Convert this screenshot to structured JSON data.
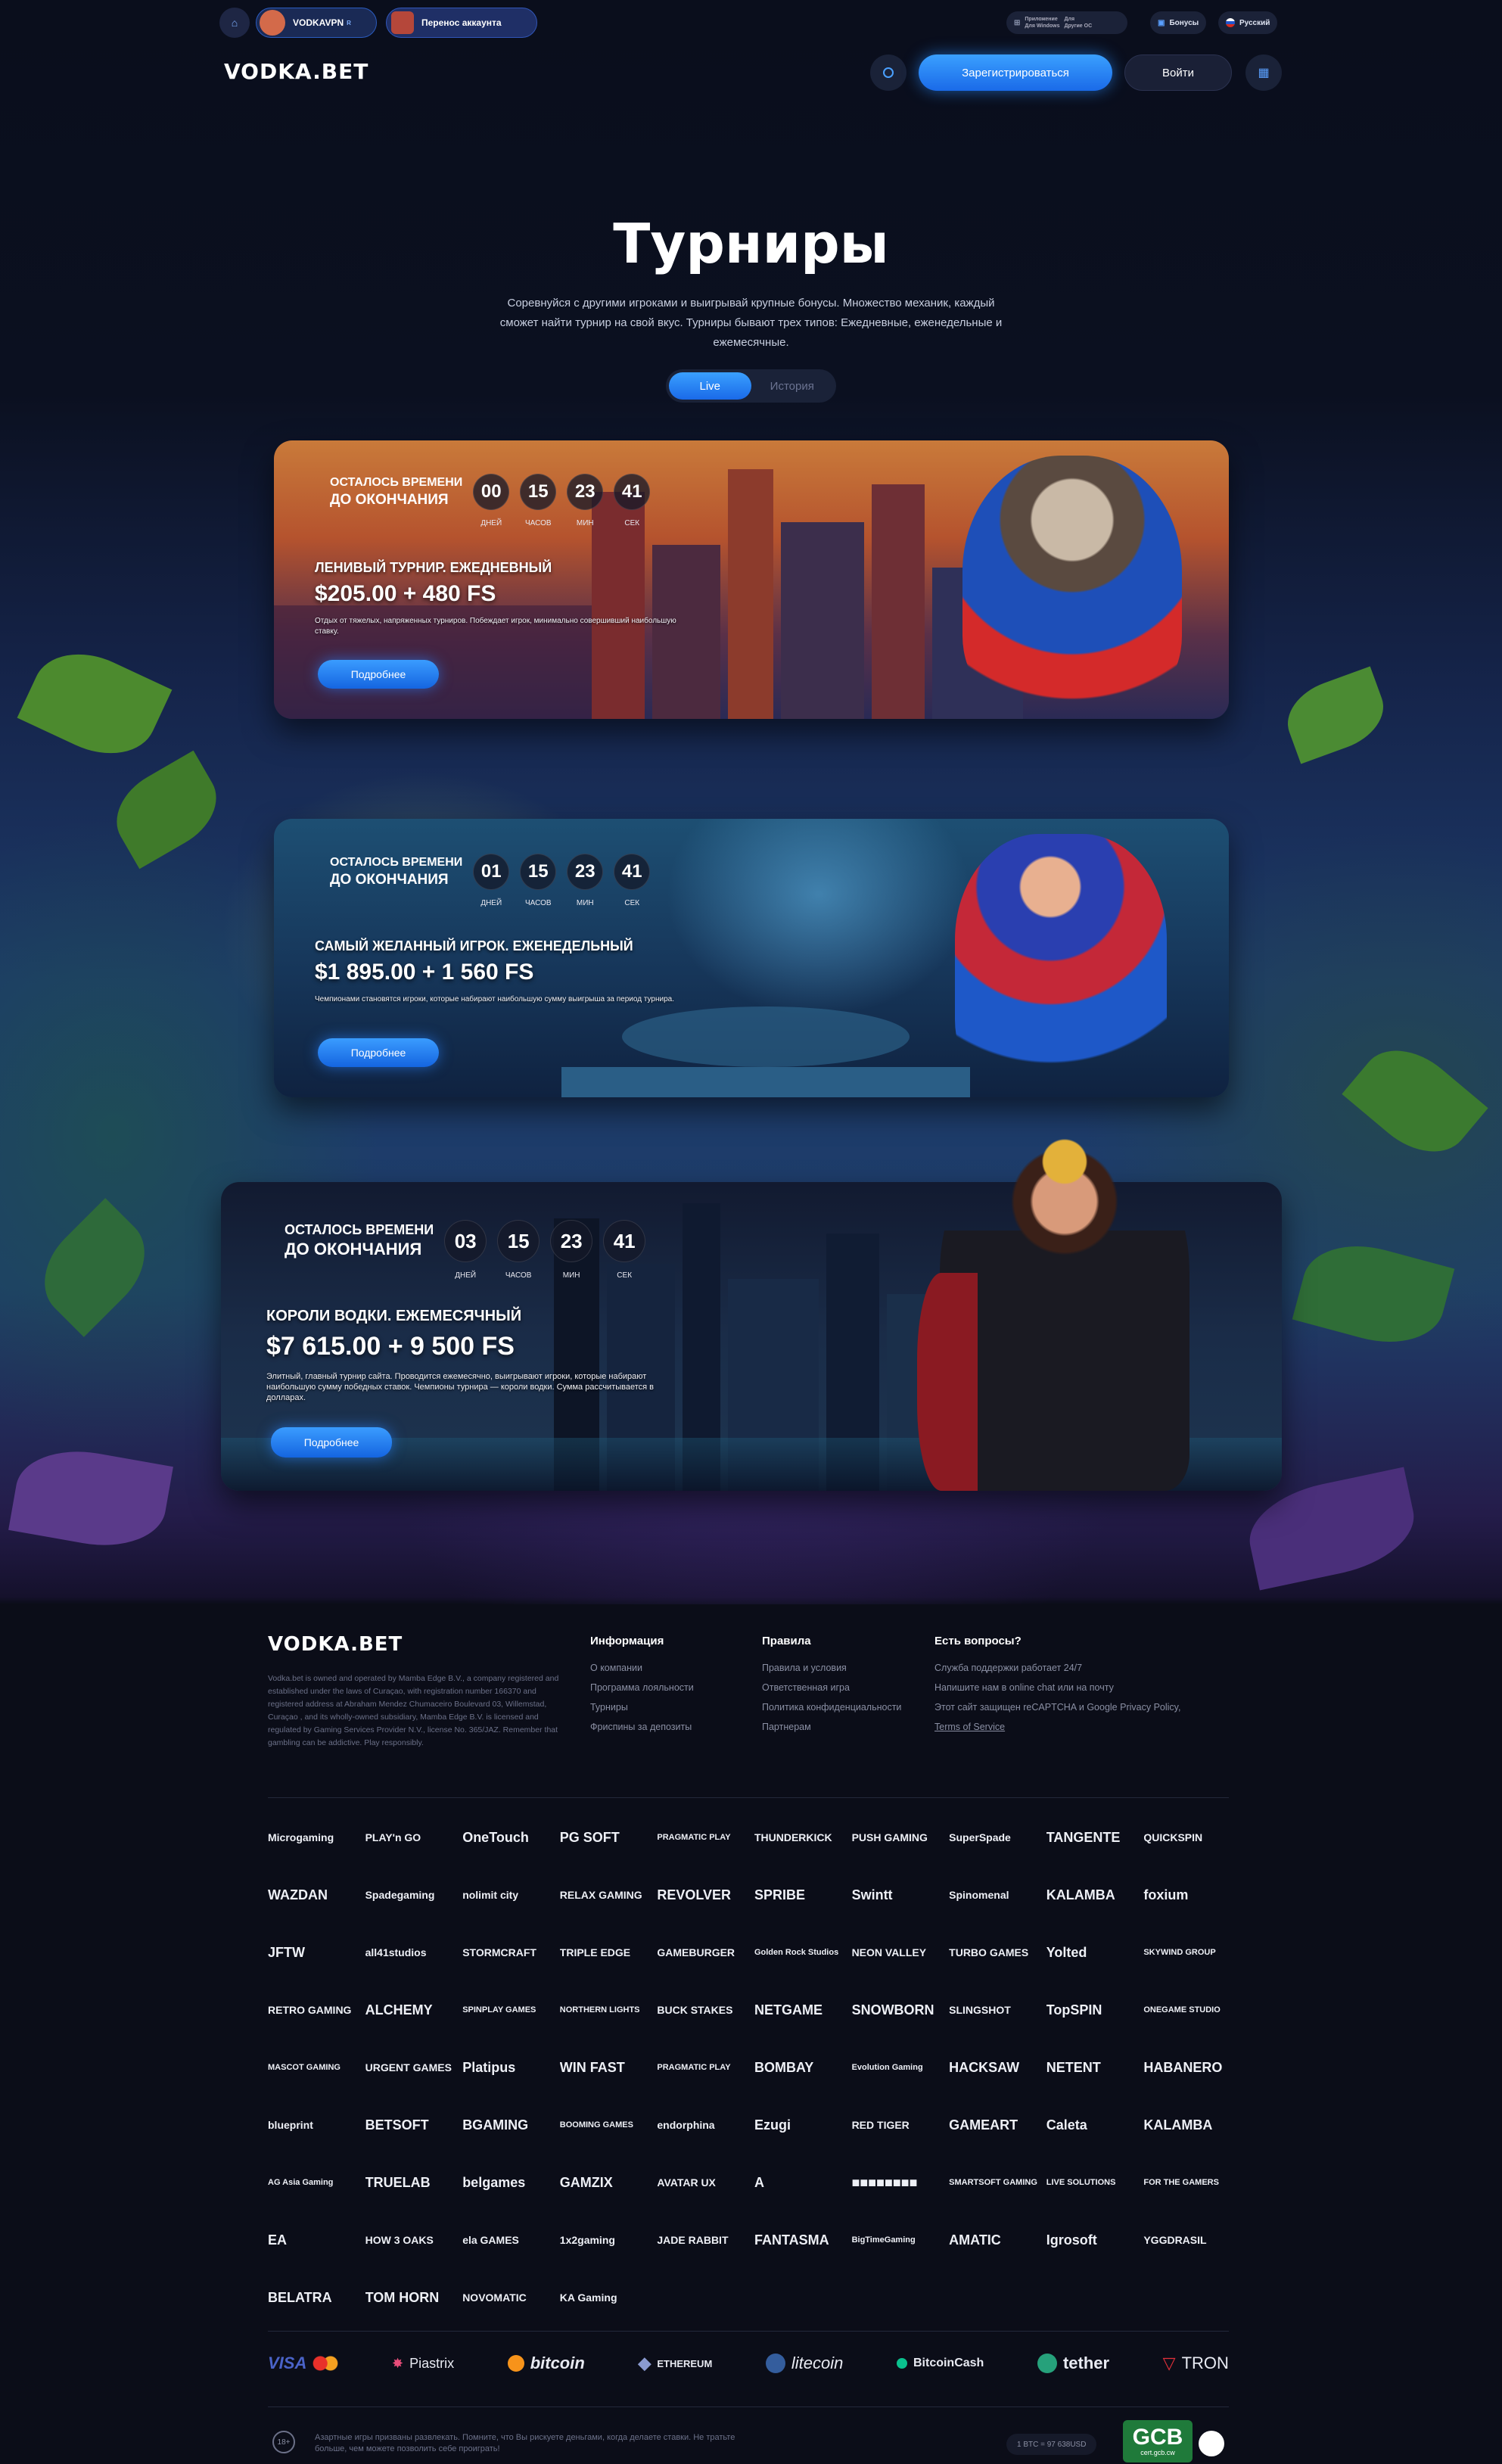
{
  "topbar": {
    "vpn_label": "VODKAVPN",
    "vpn_badge": "R",
    "transfer_label": "Перенос аккаунта",
    "app1": "Приложение",
    "app1b": "Для Windows",
    "app2": "Для",
    "app2b": "Другие ОС",
    "bonus_label": "Бонусы",
    "lang_label": "Русский"
  },
  "header": {
    "logo": "VODKA.BET",
    "register": "Зарегистрироваться",
    "login": "Войти"
  },
  "hero": {
    "title": "Турниры",
    "description": "Соревнуйся с другими игроками и выигрывай крупные бонусы. Множество механик, каждый сможет найти турнир на свой вкус. Турниры бывают трех типов: Ежедневные, еженедельные и ежемесячные.",
    "tabs": [
      "Live",
      "История"
    ]
  },
  "tournaments": [
    {
      "timer_l1": "Осталось времени",
      "timer_l2": "до окончания",
      "days": "00",
      "hours": "15",
      "mins": "23",
      "secs": "41",
      "title": "Ленивый турнир. Ежедневный",
      "prize": "$205.00 + 480 FS",
      "desc": "Отдых от тяжелых, напряженных турниров. Побеждает игрок, минимально совершивший наибольшую ставку.",
      "button": "Подробнее"
    },
    {
      "timer_l1": "Осталось времени",
      "timer_l2": "до окончания",
      "days": "01",
      "hours": "15",
      "mins": "23",
      "secs": "41",
      "title": "Самый желанный игрок. Еженедельный",
      "prize": "$1 895.00 + 1 560 FS",
      "desc": "Чемпионами становятся игроки, которые набирают наибольшую сумму выигрыша за период турнира.",
      "button": "Подробнее"
    },
    {
      "timer_l1": "Осталось времени",
      "timer_l2": "до окончания",
      "days": "03",
      "hours": "15",
      "mins": "23",
      "secs": "41",
      "title": "Короли водки. Ежемесячный",
      "prize": "$7 615.00 + 9 500 FS",
      "desc": "Элитный, главный турнир сайта. Проводится ежемесячно, выигрывают игроки, которые набирают наибольшую сумму победных ставок. Чемпионы турнира — короли водки. Сумма рассчитывается в долларах.",
      "button": "Подробнее"
    }
  ],
  "timer_units": {
    "days": "дней",
    "hours": "часов",
    "mins": "мин",
    "secs": "сек"
  },
  "footer": {
    "logo": "VODKA.BET",
    "about": "Vodka.bet is owned and operated by Mamba Edge B.V., a company registered and established under the laws of Curaçao, with registration number 166370 and registered address at Abraham Mendez Chumaceiro Boulevard 03, Willemstad, Curaçao , and its wholly-owned subsidiary, Mamba Edge B.V. is licensed and regulated by Gaming Services Provider N.V., license No. 365/JAZ. Remember that gambling can be addictive. Play responsibly.",
    "info_title": "Информация",
    "info_links": [
      "О компании",
      "Программа лояльности",
      "Турниры",
      "Фриспины за депозиты"
    ],
    "rules_title": "Правила",
    "rules_links": [
      "Правила и условия",
      "Ответственная игра",
      "Политика конфиденциальности",
      "Партнерам"
    ],
    "help_title": "Есть вопросы?",
    "help_lines": [
      "Служба поддержки работает 24/7",
      "Напишите нам в online chat или на почту",
      "Этот сайт защищен reCAPTCHA и Google Privacy Policy,",
      "Terms of Service"
    ],
    "providers": [
      [
        "Microgaming",
        "PLAY'n GO",
        "OneTouch",
        "PG SOFT",
        "PRAGMATIC PLAY",
        "THUNDERKICK",
        "PUSH GAMING",
        "SuperSpade",
        "TANGENTE",
        "QUICKSPIN"
      ],
      [
        "WAZDAN",
        "Spadegaming",
        "nolimit city",
        "RELAX GAMING",
        "REVOLVER",
        "SPRIBE",
        "Swintt",
        "Spinomenal",
        "KALAMBA",
        "foxium"
      ],
      [
        "JFTW",
        "all41studios",
        "STORMCRAFT",
        "TRIPLE EDGE",
        "GAMEBURGER",
        "Golden Rock Studios",
        "NEON VALLEY",
        "TURBO GAMES",
        "Yolted",
        "SKYWIND GROUP"
      ],
      [
        "RETRO GAMING",
        "ALCHEMY",
        "SPINPLAY GAMES",
        "NORTHERN LIGHTS",
        "BUCK STAKES",
        "NETGAME",
        "SNOWBORN",
        "SLINGSHOT",
        "TopSPIN",
        "ONEGAME STUDIO"
      ],
      [
        "MASCOT GAMING",
        "URGENT GAMES",
        "Platipus",
        "WIN FAST",
        "PRAGMATIC PLAY",
        "BOMBAY",
        "Evolution Gaming",
        "HACKSAW",
        "NETENT",
        "HABANERO"
      ],
      [
        "blueprint",
        "BETSOFT",
        "BGAMING",
        "BOOMING GAMES",
        "endorphina",
        "Ezugi",
        "RED TIGER",
        "GAMEART",
        "Caleta",
        "KALAMBA"
      ],
      [
        "AG Asia Gaming",
        "TRUELAB",
        "belgames",
        "GAMZIX",
        "AVATAR UX",
        "A",
        "■■■■■■■■",
        "SMARTSOFT GAMING",
        "LIVE SOLUTIONS",
        "FOR THE GAMERS"
      ],
      [
        "EA",
        "HOW 3 OAKS",
        "ela GAMES",
        "1x2gaming",
        "JADE RABBIT",
        "FANTASMA",
        "BigTimeGaming",
        "AMATIC",
        "Igrosoft",
        "YGGDRASIL"
      ],
      [
        "BELATRA",
        "TOM HORN",
        "NOVOMATIC",
        "KA Gaming"
      ]
    ],
    "payments": [
      "VISA",
      "Piastrix",
      "bitcoin",
      "ETHEREUM",
      "litecoin",
      "BitcoinCash",
      "tether",
      "TRON"
    ],
    "disclaimer": "Азартные игры призваны развлекать. Помните, что Вы рискуете деньгами, когда делаете ставки. Не тратьте больше, чем можете позволить себе проиграть!",
    "age": "18+",
    "rate": "1 BTC = 97 638USD",
    "gcb": "GCB",
    "gcb_sub": "cert.gcb.cw"
  },
  "colors": {
    "accent": "#2b8cff",
    "bg": "#0b0d18"
  }
}
